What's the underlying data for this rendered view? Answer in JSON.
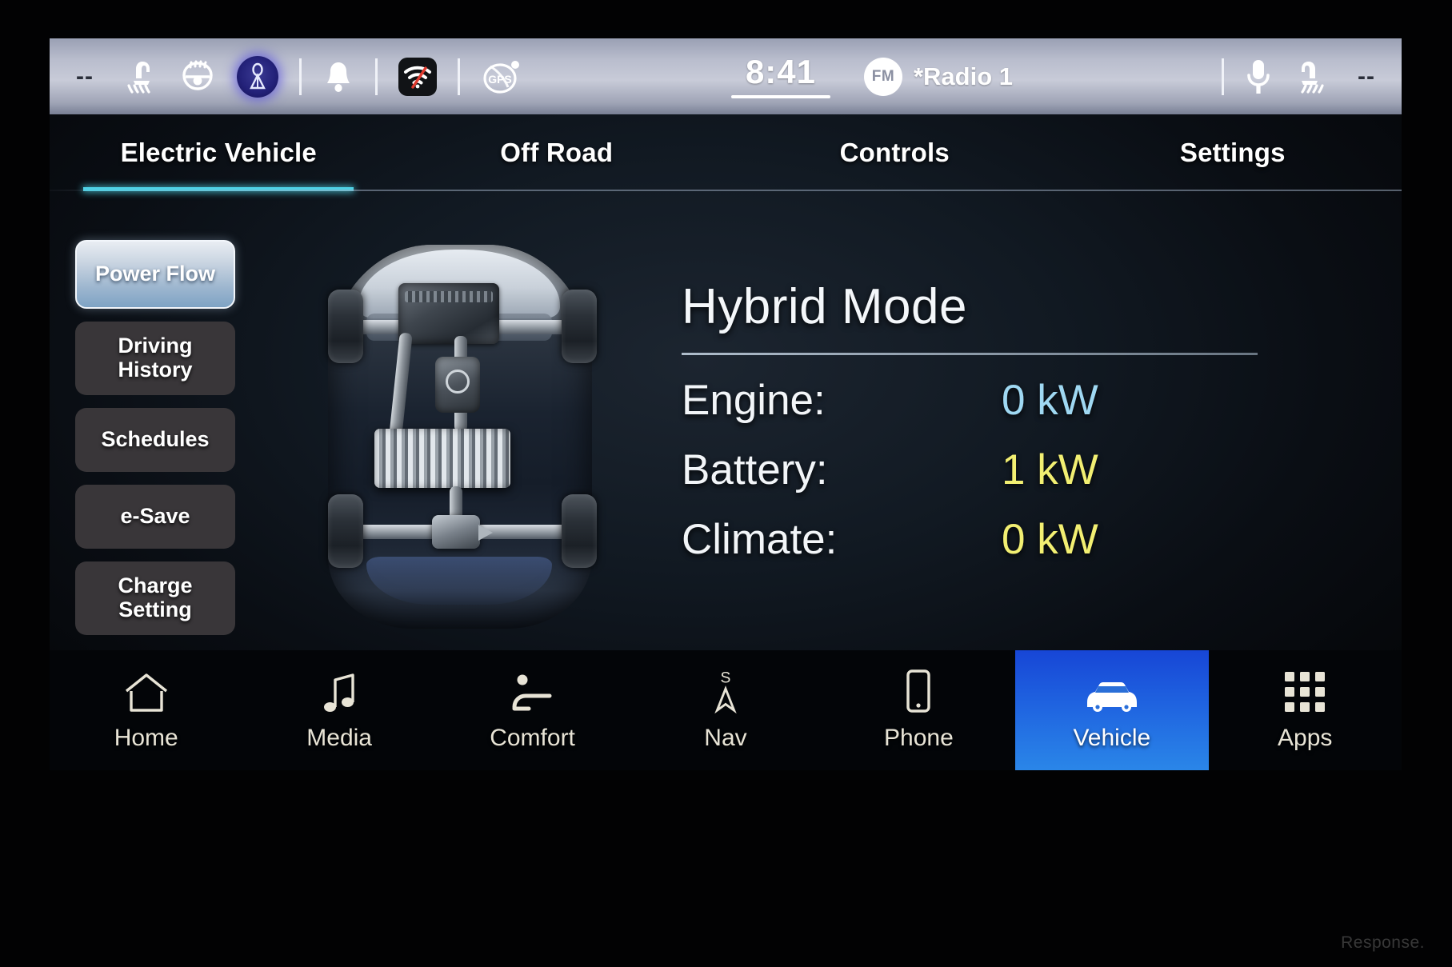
{
  "statusbar": {
    "left_dashes": "--",
    "right_dashes": "--",
    "icons": [
      {
        "name": "heated-seat-left-icon",
        "label": "Heated Seat Left"
      },
      {
        "name": "heated-steering-wheel-icon",
        "label": "Heated Steering Wheel"
      },
      {
        "name": "rear-defrost-icon",
        "label": "Rear Defrost"
      },
      {
        "name": "notification-bell-icon",
        "label": "Notifications"
      },
      {
        "name": "wifi-off-icon",
        "label": "Wi-Fi Disconnected"
      },
      {
        "name": "gps-icon",
        "label": "GPS"
      }
    ],
    "clock": "8:41",
    "source_badge": "FM",
    "source_name": "*Radio 1",
    "right_icons": [
      {
        "name": "microphone-icon",
        "label": "Voice Command"
      },
      {
        "name": "heated-seat-right-icon",
        "label": "Heated Seat Right"
      }
    ]
  },
  "tabs": [
    {
      "label": "Electric Vehicle",
      "active": true
    },
    {
      "label": "Off Road",
      "active": false
    },
    {
      "label": "Controls",
      "active": false
    },
    {
      "label": "Settings",
      "active": false
    }
  ],
  "sidebar": {
    "items": [
      {
        "label": "Power Flow",
        "active": true
      },
      {
        "label": "Driving History",
        "active": false
      },
      {
        "label": "Schedules",
        "active": false
      },
      {
        "label": "e-Save",
        "active": false
      },
      {
        "label": "Charge Setting",
        "active": false
      }
    ]
  },
  "vehicle_graphic": {
    "name": "phev-powertrain-top-view",
    "description": "Top-down cutaway of plug-in hybrid SUV showing engine, driveshaft, battery pack and rear differential"
  },
  "info_panel": {
    "title": "Hybrid Mode",
    "rows": [
      {
        "label": "Engine:",
        "value": "0 kW",
        "color": "#9fd8f2"
      },
      {
        "label": "Battery:",
        "value": "1 kW",
        "color": "#f2ef72"
      },
      {
        "label": "Climate:",
        "value": "0 kW",
        "color": "#f2ef72"
      }
    ]
  },
  "bottom_nav": {
    "items": [
      {
        "label": "Home",
        "icon": "home-icon",
        "active": false
      },
      {
        "label": "Media",
        "icon": "music-note-icon",
        "active": false
      },
      {
        "label": "Comfort",
        "icon": "seat-comfort-icon",
        "active": false
      },
      {
        "label": "Nav",
        "icon": "compass-north-icon",
        "active": false
      },
      {
        "label": "Phone",
        "icon": "phone-icon",
        "active": false
      },
      {
        "label": "Vehicle",
        "icon": "vehicle-car-icon",
        "active": true
      },
      {
        "label": "Apps",
        "icon": "apps-grid-icon",
        "active": false
      }
    ]
  },
  "watermark": "Response.",
  "colors": {
    "accent_cyan": "#4fd2e6",
    "nav_active_blue": "#1f63e0",
    "engine_value": "#9fd8f2",
    "battery_value": "#f2ef72",
    "nav_icon_cream": "#e8e4d6"
  }
}
